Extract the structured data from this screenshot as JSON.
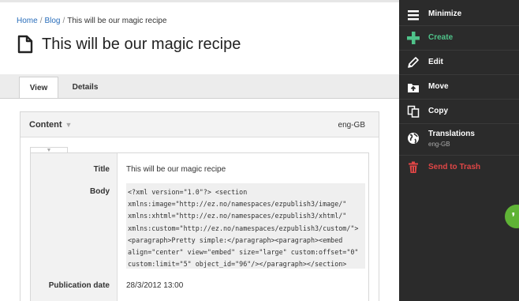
{
  "breadcrumb": {
    "items": [
      "Home",
      "Blog",
      "This will be our magic recipe"
    ],
    "separator": "/"
  },
  "page": {
    "title": "This will be our magic recipe",
    "icon": "document-icon"
  },
  "tabs": [
    {
      "label": "View",
      "active": true
    },
    {
      "label": "Details",
      "active": false
    }
  ],
  "content_panel": {
    "title": "Content",
    "language": "eng-GB",
    "fields": {
      "title_label": "Title",
      "title_value": "This will be our magic recipe",
      "body_label": "Body",
      "body_value": "<?xml version=\"1.0\"?> <section\nxmlns:image=\"http://ez.no/namespaces/ezpublish3/image/\"\nxmlns:xhtml=\"http://ez.no/namespaces/ezpublish3/xhtml/\"\nxmlns:custom=\"http://ez.no/namespaces/ezpublish3/custom/\">\n<paragraph>Pretty simple:</paragraph><paragraph><embed\nalign=\"center\" view=\"embed\" size=\"large\" custom:offset=\"0\"\ncustom:limit=\"5\" object_id=\"96\"/></paragraph></section>",
      "pubdate_label": "Publication date",
      "pubdate_value": "28/3/2012 13:00"
    }
  },
  "sidebar": {
    "items": [
      {
        "label": "Minimize",
        "icon": "menu-icon"
      },
      {
        "label": "Create",
        "icon": "plus-icon"
      },
      {
        "label": "Edit",
        "icon": "pencil-icon"
      },
      {
        "label": "Move",
        "icon": "move-folder-icon"
      },
      {
        "label": "Copy",
        "icon": "copy-icon"
      },
      {
        "label": "Translations",
        "sublabel": "eng-GB",
        "icon": "globe-icon"
      },
      {
        "label": "Send to Trash",
        "icon": "trash-icon"
      }
    ]
  },
  "colors": {
    "sidebar_bg": "#2b2b2b",
    "create": "#4fc38a",
    "trash": "#e04646",
    "link": "#2a6ebb",
    "chat": "#5fb336"
  }
}
